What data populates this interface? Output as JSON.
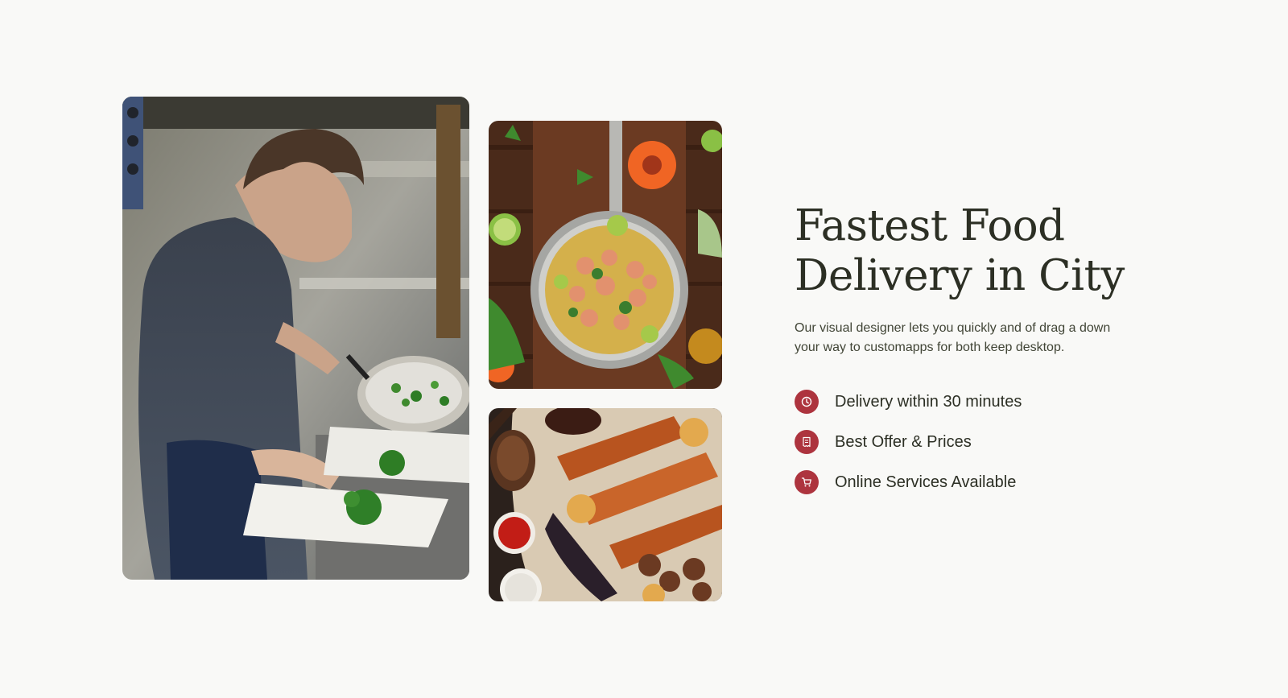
{
  "headline": {
    "line1": "Fastest Food",
    "line2": "Delivery in City"
  },
  "description": "Our visual designer lets you quickly and of drag a down your way to customapps for both keep desktop.",
  "features": [
    {
      "icon": "clock-icon",
      "label": "Delivery within 30 minutes"
    },
    {
      "icon": "receipt-icon",
      "label": "Best Offer & Prices"
    },
    {
      "icon": "cart-icon",
      "label": "Online Services Available"
    }
  ],
  "colors": {
    "background": "#f9f9f7",
    "accent": "#ad343e",
    "heading": "#2c2f24",
    "body_text": "#414536"
  }
}
